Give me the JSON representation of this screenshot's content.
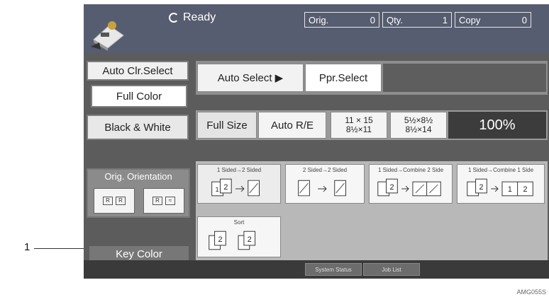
{
  "callout": {
    "number": "1",
    "figure_code": "AMG055S"
  },
  "status": {
    "ready_text": "Ready"
  },
  "counters": [
    {
      "label": "Orig.",
      "value": "0"
    },
    {
      "label": "Qty.",
      "value": "1"
    },
    {
      "label": "Copy",
      "value": "0"
    }
  ],
  "color_mode": {
    "auto": "Auto Clr.Select",
    "full": "Full Color",
    "bw": "Black & White"
  },
  "orientation": {
    "label": "Orig. Orientation"
  },
  "key_color": "Key Color",
  "paper": {
    "auto_select": "Auto Select ▶",
    "ppr_select": "Ppr.Select"
  },
  "ratio": {
    "full_size": "Full Size",
    "auto_re": "Auto R/E",
    "r1_top": "11 × 15",
    "r1_bot": "8½×11",
    "r2_top": "5½×8½",
    "r2_bot": "8½×14",
    "percent": "100%"
  },
  "modes": [
    {
      "label": "1 Sided→2 Sided"
    },
    {
      "label": "2 Sided→2 Sided"
    },
    {
      "label": "1 Sided→Combine 2 Side"
    },
    {
      "label": "1 Sided→Combine 1 Side"
    },
    {
      "label": "Sort"
    }
  ],
  "bottom": {
    "system_status": "System Status",
    "job_list": "Job List"
  },
  "colors": {
    "screen_bg": "#5c5c5c",
    "topbar": "#575d70",
    "accent_dark": "#3c3c3c"
  }
}
